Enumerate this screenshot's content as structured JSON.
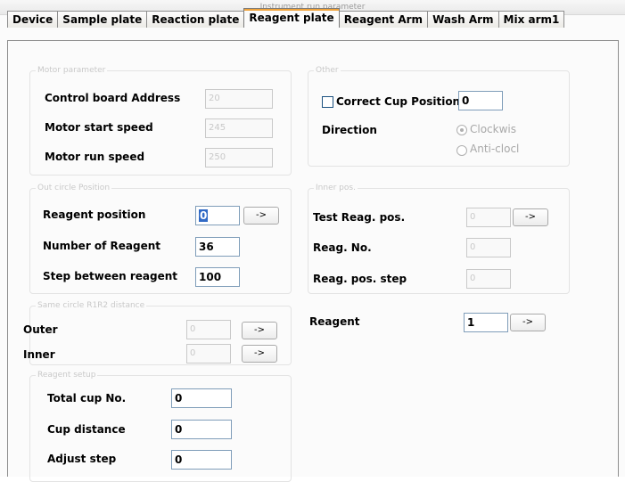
{
  "window": {
    "title": "Instrument run parameter"
  },
  "tabs": [
    {
      "label": "Device"
    },
    {
      "label": "Sample plate"
    },
    {
      "label": "Reaction plate"
    },
    {
      "label": "Reagent plate",
      "active": true
    },
    {
      "label": "Reagent Arm"
    },
    {
      "label": "Wash Arm"
    },
    {
      "label": "Mix arm1"
    }
  ],
  "motor": {
    "legend": "Motor parameter",
    "control_board_label": "Control board Address",
    "control_board_value": "20",
    "start_speed_label": "Motor start speed",
    "start_speed_value": "245",
    "run_speed_label": "Motor run speed",
    "run_speed_value": "250"
  },
  "other": {
    "legend": "Other",
    "correct_cup_label": "Correct Cup Position",
    "correct_cup_value": "0",
    "direction_label": "Direction",
    "clockwise_label": "Clockwis",
    "anticlockwise_label": "Anti-clocl"
  },
  "outer_circle": {
    "legend": "Out circle Position",
    "reagent_position_label": "Reagent position",
    "reagent_position_value": "0",
    "go_button": "->",
    "number_of_reagent_label": "Number of Reagent",
    "number_of_reagent_value": "36",
    "step_between_label": "Step between reagent",
    "step_between_value": "100"
  },
  "inner_pos": {
    "legend": "Inner pos.",
    "test_reag_label": "Test Reag. pos.",
    "test_reag_value": "0",
    "go_button": "->",
    "reag_no_label": "Reag. No.",
    "reag_no_value": "0",
    "reag_step_label": "Reag. pos. step",
    "reag_step_value": "0"
  },
  "same_circle": {
    "legend": "Same circle R1R2 distance",
    "outer_label": "Outer",
    "outer_value": "0",
    "inner_label": "Inner",
    "inner_value": "0",
    "go_button": "->"
  },
  "reagent": {
    "label": "Reagent",
    "value": "1",
    "go_button": "->"
  },
  "reagent_setup": {
    "legend": "Reagent setup",
    "total_cup_label": "Total cup No.",
    "total_cup_value": "0",
    "cup_distance_label": "Cup distance",
    "cup_distance_value": "0",
    "adjust_step_label": "Adjust step",
    "adjust_step_value": "0"
  }
}
